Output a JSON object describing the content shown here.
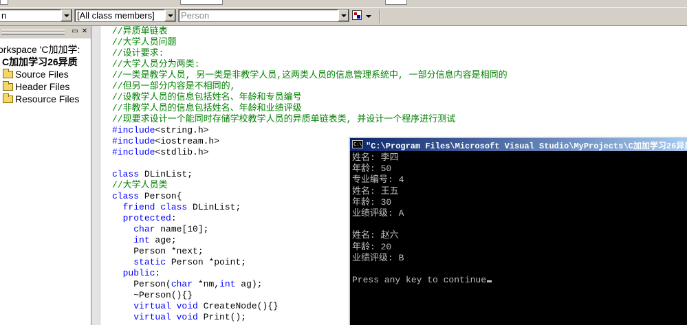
{
  "toolbar": {
    "class_combo": "n",
    "members_combo": "[All class members]",
    "function_combo": "Person"
  },
  "workspace": {
    "root": "orkspace 'C加加学:",
    "project": "C加加学习26异质",
    "folders": [
      "Source Files",
      "Header Files",
      "Resource Files"
    ],
    "buttons": {
      "restore": "▭",
      "close": "✕"
    }
  },
  "code_lines": [
    {
      "parts": [
        {
          "t": "//异质单链表",
          "c": "cm"
        }
      ]
    },
    {
      "parts": [
        {
          "t": "//大学人员问题",
          "c": "cm"
        }
      ]
    },
    {
      "parts": [
        {
          "t": "//设计要求:",
          "c": "cm"
        }
      ]
    },
    {
      "parts": [
        {
          "t": "//大学人员分为两类:",
          "c": "cm"
        }
      ]
    },
    {
      "parts": [
        {
          "t": "//一类是教学人员, 另一类是非教学人员,这两类人员的信息管理系统中, 一部分信息内容是相同的",
          "c": "cm"
        }
      ]
    },
    {
      "parts": [
        {
          "t": "//但另一部分内容是不相同的,",
          "c": "cm"
        }
      ]
    },
    {
      "parts": [
        {
          "t": "//设教学人员的信息包括姓名、年龄和专员编号",
          "c": "cm"
        }
      ]
    },
    {
      "parts": [
        {
          "t": "//非教学人员的信息包括姓名、年龄和业绩评级",
          "c": "cm"
        }
      ]
    },
    {
      "parts": [
        {
          "t": "//现要求设计一个能同时存储学校教学人员的异质单链表类, 并设计一个程序进行测试",
          "c": "cm"
        }
      ]
    },
    {
      "parts": [
        {
          "t": "#include",
          "c": "kw"
        },
        {
          "t": "<string.h>",
          "c": ""
        }
      ]
    },
    {
      "parts": [
        {
          "t": "#include",
          "c": "kw"
        },
        {
          "t": "<iostream.h>",
          "c": ""
        }
      ]
    },
    {
      "parts": [
        {
          "t": "#include",
          "c": "kw"
        },
        {
          "t": "<stdlib.h>",
          "c": ""
        }
      ]
    },
    {
      "parts": []
    },
    {
      "parts": [
        {
          "t": "class",
          "c": "kw"
        },
        {
          "t": " DLinList;",
          "c": ""
        }
      ]
    },
    {
      "parts": [
        {
          "t": "//大学人员类",
          "c": "cm"
        }
      ]
    },
    {
      "parts": [
        {
          "t": "class",
          "c": "kw"
        },
        {
          "t": " Person{",
          "c": ""
        }
      ]
    },
    {
      "parts": [
        {
          "t": "  ",
          "c": ""
        },
        {
          "t": "friend class",
          "c": "kw"
        },
        {
          "t": " DLinList;",
          "c": ""
        }
      ]
    },
    {
      "parts": [
        {
          "t": "  ",
          "c": ""
        },
        {
          "t": "protected",
          "c": "kw"
        },
        {
          "t": ":",
          "c": ""
        }
      ]
    },
    {
      "parts": [
        {
          "t": "    ",
          "c": ""
        },
        {
          "t": "char",
          "c": "kw"
        },
        {
          "t": " name[10];",
          "c": ""
        }
      ]
    },
    {
      "parts": [
        {
          "t": "    ",
          "c": ""
        },
        {
          "t": "int",
          "c": "kw"
        },
        {
          "t": " age;",
          "c": ""
        }
      ]
    },
    {
      "parts": [
        {
          "t": "    Person *next;",
          "c": ""
        }
      ]
    },
    {
      "parts": [
        {
          "t": "    ",
          "c": ""
        },
        {
          "t": "static",
          "c": "kw"
        },
        {
          "t": " Person *point;",
          "c": ""
        }
      ]
    },
    {
      "parts": [
        {
          "t": "  ",
          "c": ""
        },
        {
          "t": "public",
          "c": "kw"
        },
        {
          "t": ":",
          "c": ""
        }
      ]
    },
    {
      "parts": [
        {
          "t": "    Person(",
          "c": ""
        },
        {
          "t": "char",
          "c": "kw"
        },
        {
          "t": " *nm,",
          "c": ""
        },
        {
          "t": "int",
          "c": "kw"
        },
        {
          "t": " ag);",
          "c": ""
        }
      ]
    },
    {
      "parts": [
        {
          "t": "    ~Person(){}",
          "c": ""
        }
      ]
    },
    {
      "parts": [
        {
          "t": "    ",
          "c": ""
        },
        {
          "t": "virtual void",
          "c": "kw"
        },
        {
          "t": " CreateNode(){}",
          "c": ""
        }
      ]
    },
    {
      "parts": [
        {
          "t": "    ",
          "c": ""
        },
        {
          "t": "virtual void",
          "c": "kw"
        },
        {
          "t": " Print();",
          "c": ""
        }
      ]
    }
  ],
  "console": {
    "title": "\"C:\\Program Files\\Microsoft Visual Studio\\MyProjects\\C加加学习26异质",
    "icon_text": "C:\\",
    "lines": [
      "姓名: 李四",
      "年龄: 50",
      "专业编号: 4",
      "姓名: 王五",
      "年龄: 30",
      "业绩评级: A",
      "",
      "姓名: 赵六",
      "年龄: 20",
      "业绩评级: B",
      "",
      "Press any key to continue"
    ]
  }
}
